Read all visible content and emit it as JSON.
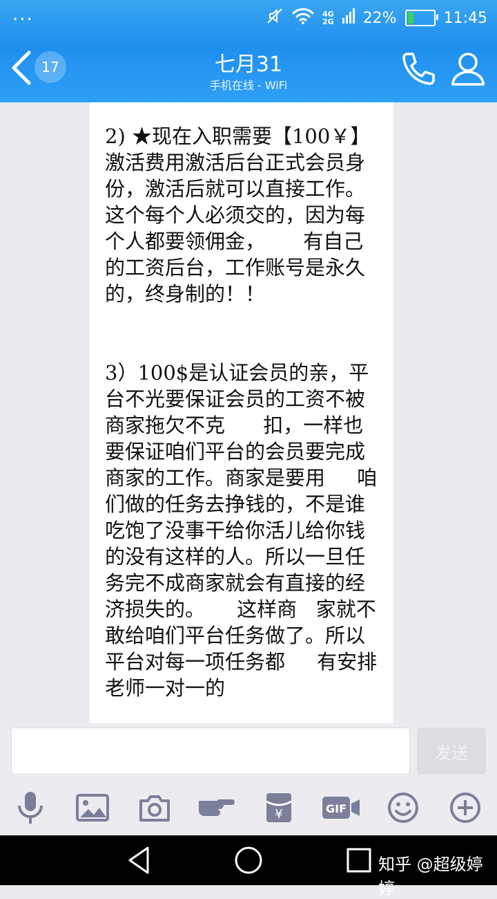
{
  "status_bar": {
    "menu_dots": "...",
    "network_top": "4G",
    "network_bottom": "2G",
    "battery_percent": "22%",
    "battery_level": 0.22,
    "time": "11:45"
  },
  "header": {
    "unread_count": "17",
    "title": "七月31",
    "subtitle": "手机在线 - WiFi",
    "icons": [
      "back-arrow-icon",
      "phone-icon",
      "contact-icon"
    ]
  },
  "message": {
    "paragraph_1": "2) ★现在入职需要【100￥】激活费用激活后台正式会员身份，激活后就可以直接工作。这个每个人必须交的，因为每个人都要领佣金，      有自己的工资后台，工作账号是永久的，终身制的！！",
    "paragraph_2": "3）100$是认证会员的亲，平台不光要保证会员的工资不被商家拖欠不克      扣，一样也要保证咱们平台的会员要完成商家的工作。商家是要用     咱们做的任务去挣钱的，不是谁吃饱了没事干给你活儿给你钱的没有这样的人。所以一旦任务完不成商家就会有直接的经济损失的。     这样商   家就不敢给咱们平台任务做了。所以平台对每一项任务都     有安排老师一对一的"
  },
  "input_bar": {
    "value": "",
    "send_label": "发送"
  },
  "toolbar": {
    "items": [
      "microphone-icon",
      "image-icon",
      "camera-icon",
      "poke-icon",
      "red-packet-icon",
      "gif-icon",
      "emoji-icon",
      "plus-icon"
    ]
  },
  "nav_bar": {
    "watermark": "知乎 @超级婷婷"
  }
}
